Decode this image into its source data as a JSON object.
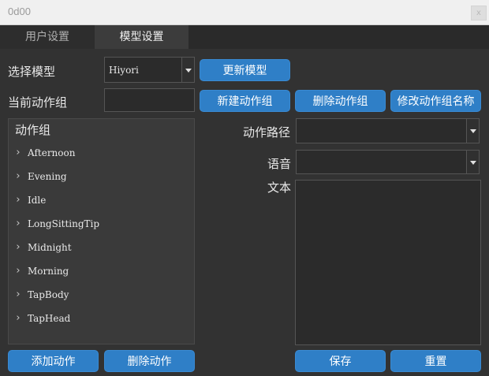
{
  "window": {
    "title": "0d00",
    "close_glyph": "x"
  },
  "tabs": [
    {
      "label": "用户设置",
      "active": false
    },
    {
      "label": "模型设置",
      "active": true
    }
  ],
  "model": {
    "select_label": "选择模型",
    "selected_model": "Hiyori",
    "update_button": "更新模型"
  },
  "group": {
    "current_label": "当前动作组",
    "current_value": "",
    "new_button": "新建动作组",
    "delete_button": "删除动作组",
    "rename_button": "修改动作组名称"
  },
  "tree": {
    "header": "动作组",
    "items": [
      "Afternoon",
      "Evening",
      "Idle",
      "LongSittingTip",
      "Midnight",
      "Morning",
      "TapBody",
      "TapHead"
    ]
  },
  "motion": {
    "path_label": "动作路径",
    "path_value": "",
    "voice_label": "语音",
    "voice_value": "",
    "text_label": "文本",
    "text_value": ""
  },
  "actions": {
    "add_motion": "添加动作",
    "delete_motion": "删除动作",
    "save": "保存",
    "reset": "重置"
  },
  "colors": {
    "accent": "#2f7fc7",
    "background": "#323232",
    "panel": "#3a3a3a",
    "field": "#2b2b2b"
  }
}
